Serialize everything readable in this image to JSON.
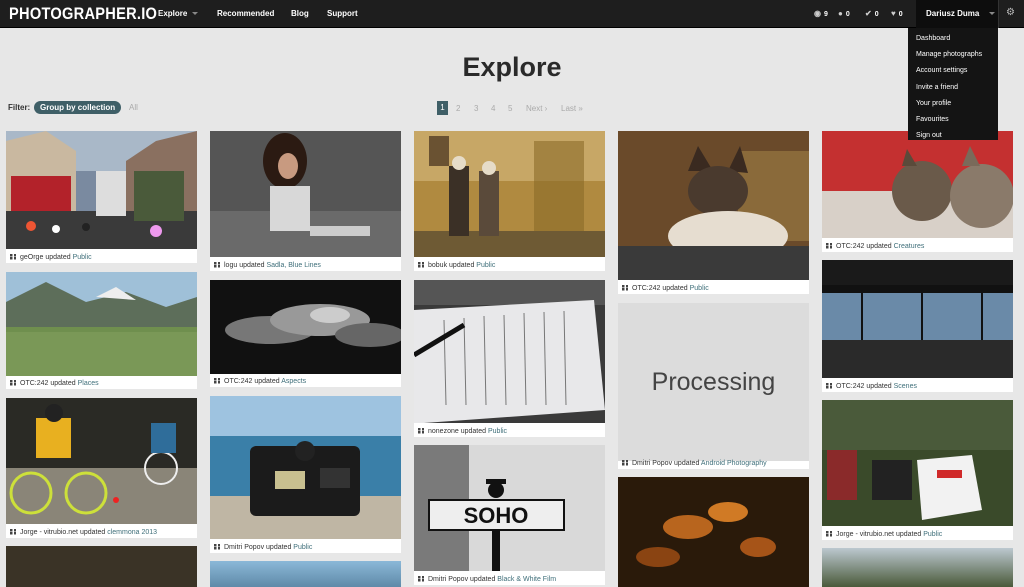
{
  "navbar": {
    "logo": "PHOTOGRAPHER.IO",
    "items": [
      "Explore",
      "Recommended",
      "Blog",
      "Support"
    ],
    "stats": {
      "views": "9",
      "followers": "0",
      "checks": "0",
      "likes": "0"
    },
    "user_name": "Dariusz Duma"
  },
  "user_menu": [
    "Dashboard",
    "Manage photographs",
    "Account settings",
    "Invite a friend",
    "Your profile",
    "Favourites",
    "Sign out"
  ],
  "page": {
    "title": "Explore"
  },
  "filter": {
    "label": "Filter:",
    "active": "Group by collection",
    "all": "All"
  },
  "pagination": {
    "pages": [
      "1",
      "2",
      "3",
      "4",
      "5"
    ],
    "next": "Next ›",
    "last": "Last »"
  },
  "tiles": [
    {
      "user": "geOrge",
      "updated": "updated",
      "collection": "Public"
    },
    {
      "user": "OTC:242",
      "updated": "updated",
      "collection": "Places"
    },
    {
      "user": "Jorge - vitrubio.net",
      "updated": "updated",
      "collection": "clemmona 2013"
    },
    {
      "user": "logu",
      "updated": "updated",
      "collection": "Sadla, Blue Lines"
    },
    {
      "user": "OTC:242",
      "updated": "updated",
      "collection": "Aspects"
    },
    {
      "user": "Dmitri Popov",
      "updated": "updated",
      "collection": "Public"
    },
    {
      "user": "bobuk",
      "updated": "updated",
      "collection": "Public"
    },
    {
      "user": "nonezone",
      "updated": "updated",
      "collection": "Public"
    },
    {
      "user": "Dmitri Popov",
      "updated": "updated",
      "collection": "Black & White Film"
    },
    {
      "user": "OTC:242",
      "updated": "updated",
      "collection": "Public"
    },
    {
      "user": "Dmitri Popov",
      "updated": "updated",
      "collection": "Android Photography"
    },
    {
      "user": "OTC:242",
      "updated": "updated",
      "collection": "Creatures"
    },
    {
      "user": "OTC:242",
      "updated": "updated",
      "collection": "Scenes"
    },
    {
      "user": "Jorge - vitrubio.net",
      "updated": "updated",
      "collection": "Public"
    }
  ],
  "processing_text": "Processing",
  "soho_text": "SOHO",
  "colors": {
    "topbar": "#1e1e1e",
    "accent": "#3f5f67",
    "link": "#3f6f7a",
    "background": "#e7e7e7"
  }
}
